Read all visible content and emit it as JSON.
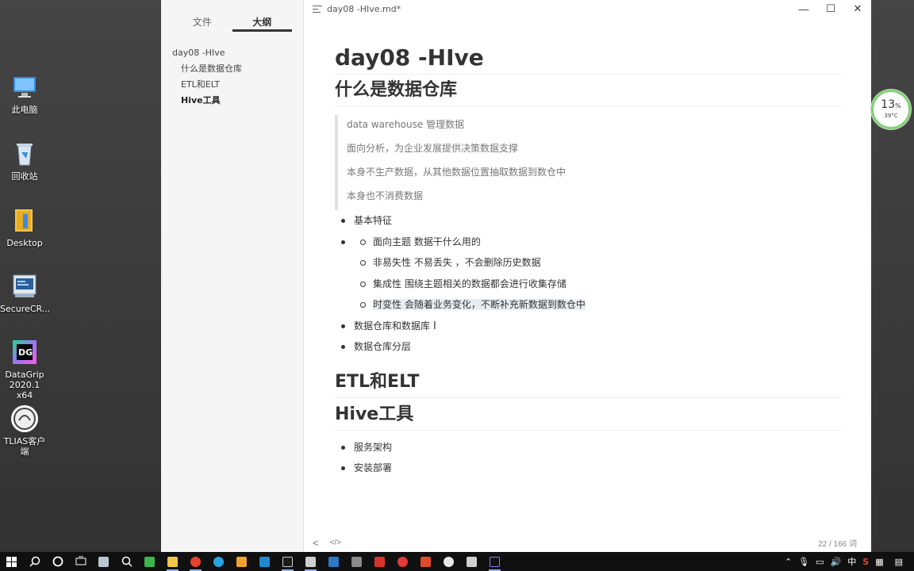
{
  "desktop": {
    "icons": [
      {
        "label": "此电脑",
        "icon": "computer-icon"
      },
      {
        "label": "回收站",
        "icon": "recycle-bin-icon"
      },
      {
        "label": "Desktop",
        "icon": "folder-icon"
      },
      {
        "label": "SecureCR...",
        "icon": "securecrt-icon"
      },
      {
        "label": "DataGrip\n2020.1 x64",
        "label_l1": "DataGrip",
        "label_l2": "2020.1 x64",
        "icon": "datagrip-icon"
      },
      {
        "label": "TLIAS客户端",
        "icon": "tlias-icon"
      }
    ]
  },
  "sidebar": {
    "tabs": [
      {
        "label": "文件"
      },
      {
        "label": "大纲"
      }
    ],
    "active_tab": "大纲",
    "outline": [
      {
        "label": "day08 -HIve",
        "level": 1
      },
      {
        "label": "什么是数据仓库",
        "level": 2
      },
      {
        "label": "ETL和ELT",
        "level": 2
      },
      {
        "label": "Hive工具",
        "level": 2
      }
    ]
  },
  "window": {
    "title": "day08 -HIve.md*",
    "buttons": {
      "minimize": "—",
      "maximize": "☐",
      "close": "✕"
    }
  },
  "doc": {
    "h1": "day08 -HIve",
    "h2_1": "什么是数据仓库",
    "quote": [
      "data warehouse   管理数据",
      "面向分析，为企业发展提供决策数据支撑",
      "本身不生产数据，从其他数据位置抽取数据到数仓中",
      "本身也不消费数据"
    ],
    "list1": {
      "item1": "基本特征",
      "sub": [
        "面向主题   数据干什么用的",
        "非易失性   不易丢失 ，不会删除历史数据",
        "集成性  围绕主题相关的数据都会进行收集存储",
        "时变性  会随着业务变化，不断补充新数据到数仓中"
      ],
      "item2": "数据仓库和数据库",
      "item3": "数据仓库分层"
    },
    "h2_2": "ETL和ELT",
    "h2_3": "Hive工具",
    "list2": [
      "服务架构",
      "安装部署"
    ]
  },
  "statusbar": {
    "back": "<",
    "code": "</>",
    "word_count": "22 / 166 词"
  },
  "gauge": {
    "percent": "13",
    "percent_sign": "%",
    "temp": "39°C",
    "color": "#7ed36f"
  },
  "tray": {
    "ime": "中"
  }
}
